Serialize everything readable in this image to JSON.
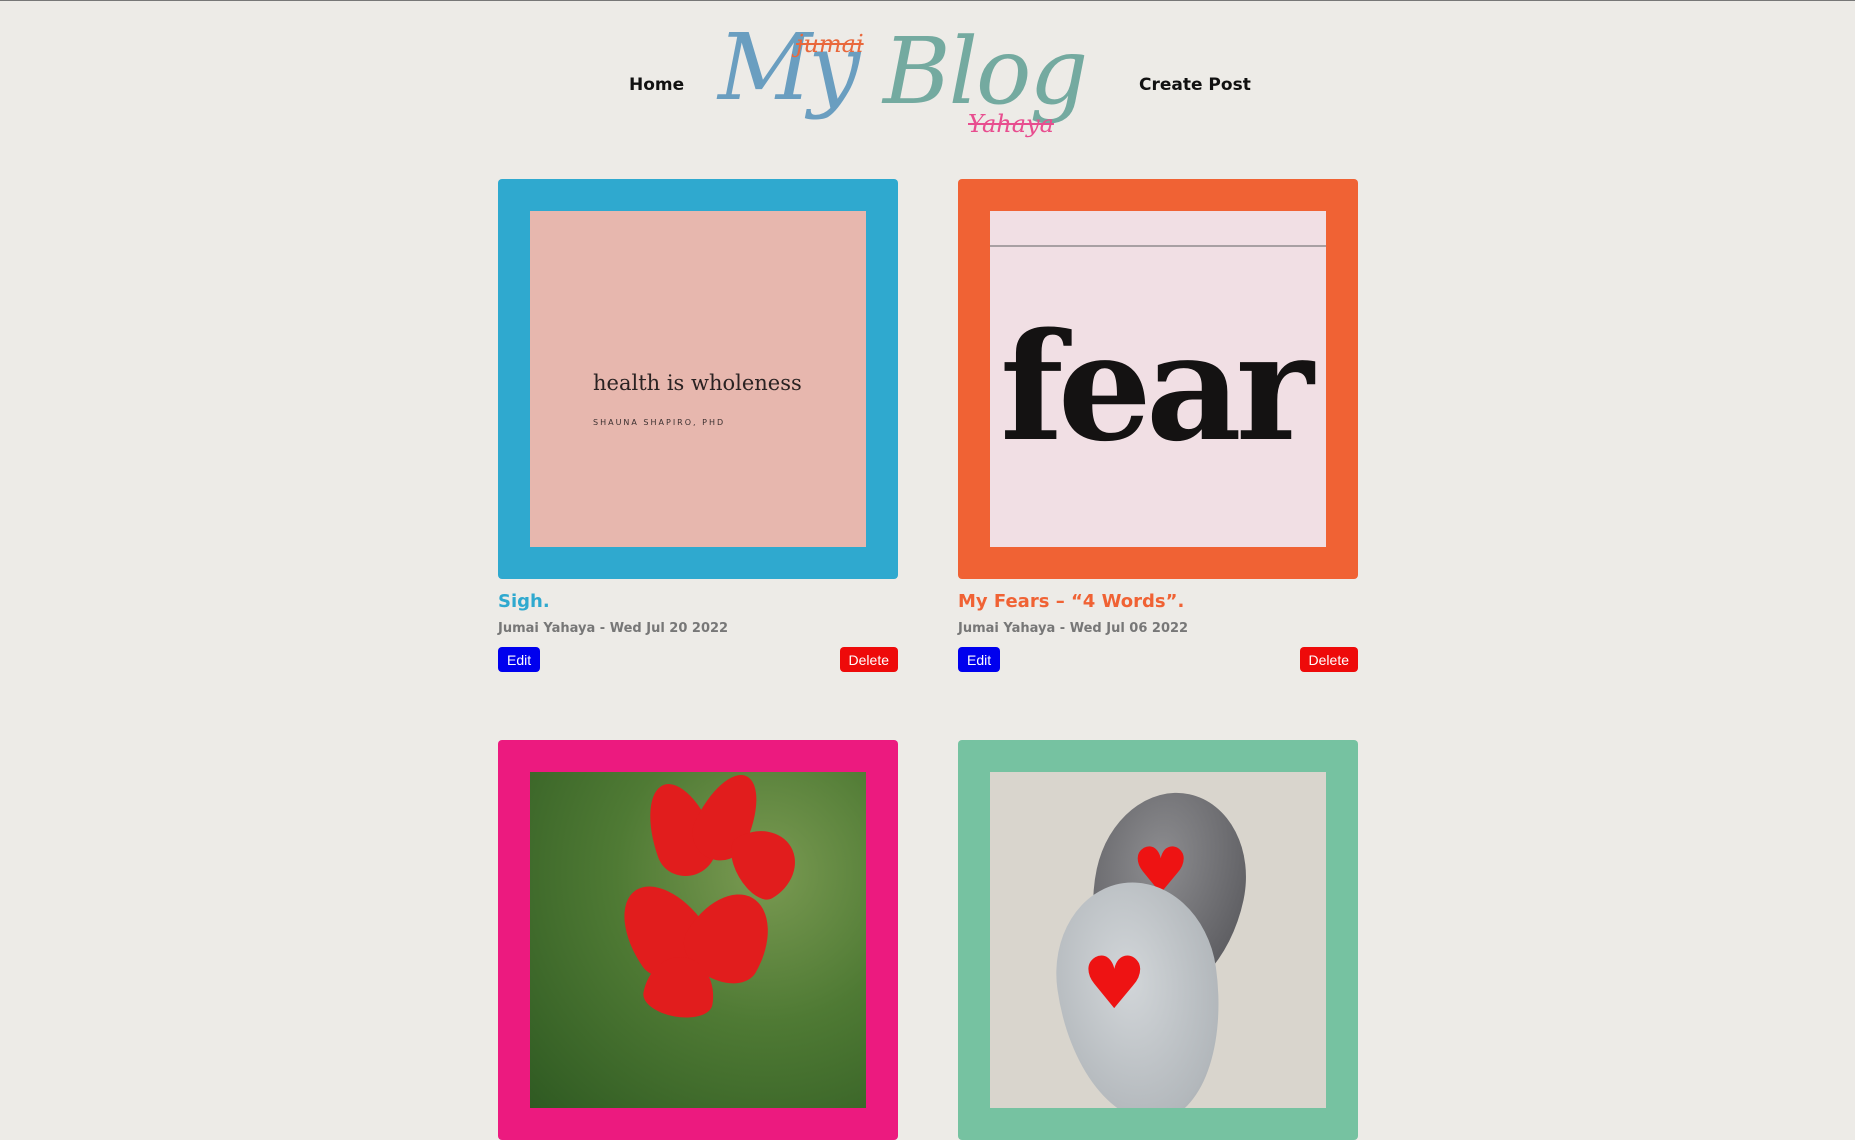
{
  "nav": {
    "home": "Home",
    "create_post": "Create Post"
  },
  "logo": {
    "main_my": "My",
    "main_blog": "Blog",
    "first_name": "jumai",
    "last_name": "Yahaya"
  },
  "posts": [
    {
      "title": "Sigh.",
      "meta": "Jumai Yahaya - Wed Jul 20 2022",
      "edit_label": "Edit",
      "delete_label": "Delete",
      "frame_color": "#2fa9cf",
      "image_text": "health is wholeness",
      "image_subtext": "SHAUNA SHAPIRO, PHD"
    },
    {
      "title": "My Fears – “4 Words”.",
      "meta": "Jumai Yahaya - Wed Jul 06 2022",
      "edit_label": "Edit",
      "delete_label": "Delete",
      "frame_color": "#f06234",
      "image_text": "fear"
    },
    {
      "frame_color": "#ec1a7f",
      "image_icon": "red-flower-image"
    },
    {
      "frame_color": "#76c2a1",
      "image_icon": "heart-stones-image"
    }
  ]
}
